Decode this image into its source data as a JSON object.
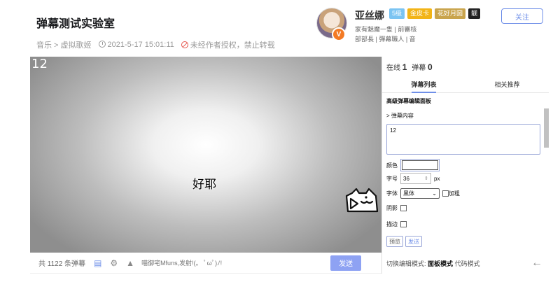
{
  "header": {
    "title": "弹幕测试实验室",
    "category": "音乐 > 虚拟歌姬",
    "datetime": "2021-5-17 15:01:11",
    "copyright": "未经作者授权，禁止转载"
  },
  "uploader": {
    "name": "亚丝娜",
    "badges": [
      "5级",
      "金皮卡",
      "花好月圆",
      "靓"
    ],
    "follow_label": "关注",
    "signature_line1": "家有魅魔一隻 | 前審核",
    "signature_line2": "部部長 | 彈幕職人 | 音",
    "avatar_badge": "V"
  },
  "player": {
    "frame_counter": "12",
    "danmaku_text": "好耶",
    "logo_icon": "acfun-logo-icon"
  },
  "bottombar": {
    "danmaku_count": "共 1122 条弹幕",
    "input_placeholder": "喵御宅Mfuns,发射!(。 ﾟωﾟ)ﾉ!",
    "send_label": "发送"
  },
  "panel": {
    "online_label": "在线",
    "online_count": "1",
    "danmaku_label": "弹幕",
    "danmaku_count": "0",
    "tabs": [
      {
        "label": "弹幕列表"
      },
      {
        "label": "相关推荐"
      }
    ],
    "section_title": "高级弹幕编辑面板",
    "content_title": "> 弹幕内容",
    "content_value": "12",
    "color_label": "颜色",
    "size_label": "字号",
    "size_value": "36",
    "size_unit": "px",
    "font_label": "字体",
    "font_value": "黑体",
    "bold_label": "加粗",
    "shadow_label": "阴影",
    "stroke_label": "描边",
    "preview_label": "预览",
    "send_label": "发送",
    "mode_prefix": "切换编辑模式:",
    "mode_current": "面板模式",
    "mode_alt": "代码模式"
  },
  "colors": {
    "accent": "#6f8fe8",
    "send_button": "#8ea2f3",
    "avatar_badge": "#f37a24"
  }
}
